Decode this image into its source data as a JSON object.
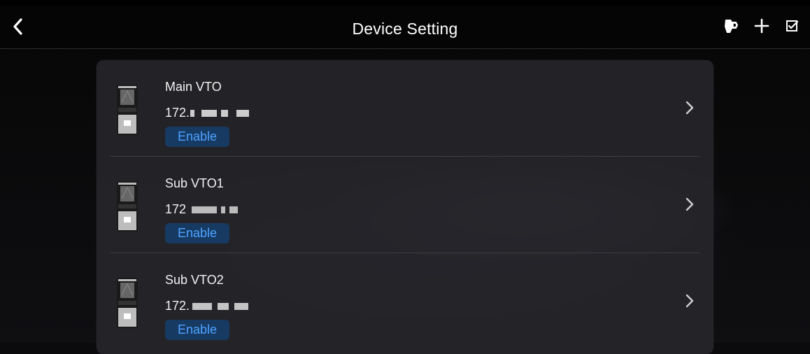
{
  "header": {
    "title": "Device Setting",
    "icons": [
      "back-icon",
      "card-icon",
      "add-icon",
      "edit-icon"
    ]
  },
  "devices": [
    {
      "name": "Main VTO",
      "ip": "172.",
      "status": "Enable"
    },
    {
      "name": "Sub VTO1",
      "ip": "172",
      "status": "Enable"
    },
    {
      "name": "Sub VTO2",
      "ip": "172.",
      "status": "Enable"
    }
  ],
  "colors": {
    "background": "#0b0b0d",
    "panel": "#26262a",
    "accent": "#4ea3ff",
    "badge": "#173a63"
  }
}
